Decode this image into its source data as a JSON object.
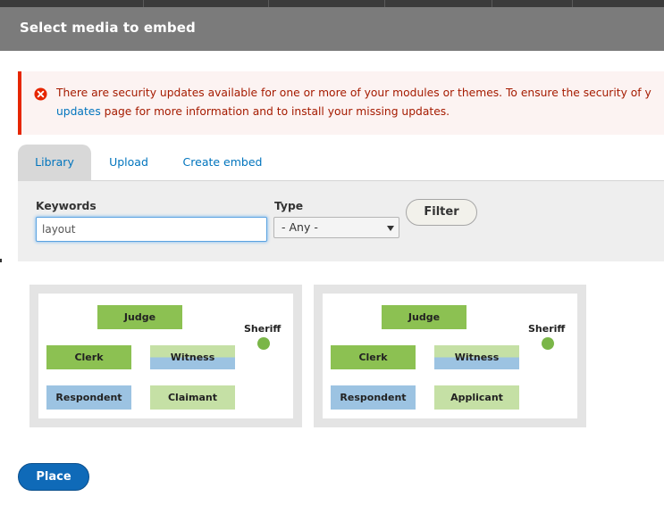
{
  "dialog": {
    "title": "Select media to embed"
  },
  "alert": {
    "icon": "error-icon",
    "line1": "There are security updates available for one or more of your modules or themes. To ensure the security of y",
    "link_text": "updates",
    "line2_rest": " page for more information and to install your missing updates.",
    "color": "#a51b00",
    "border_color": "#e62600"
  },
  "tabs": [
    {
      "label": "Library",
      "active": true
    },
    {
      "label": "Upload",
      "active": false
    },
    {
      "label": "Create embed",
      "active": false
    }
  ],
  "filters": {
    "keywords_label": "Keywords",
    "keywords_value": "layout",
    "type_label": "Type",
    "type_selected": "- Any -",
    "filter_button": "Filter"
  },
  "media": [
    {
      "judge": "Judge",
      "sheriff": "Sheriff",
      "clerk": "Clerk",
      "witness": "Witness",
      "respondent": "Respondent",
      "party": "Claimant"
    },
    {
      "judge": "Judge",
      "sheriff": "Sheriff",
      "clerk": "Clerk",
      "witness": "Witness",
      "respondent": "Respondent",
      "party": "Applicant"
    }
  ],
  "actions": {
    "place_button": "Place"
  },
  "colors": {
    "titlebar": "#7b7b7b",
    "link": "#0074bd",
    "primary_button": "#0f6ab8",
    "green_dark": "#8cc152",
    "green_light": "#c5e0a5",
    "blue": "#9cc3e2"
  }
}
